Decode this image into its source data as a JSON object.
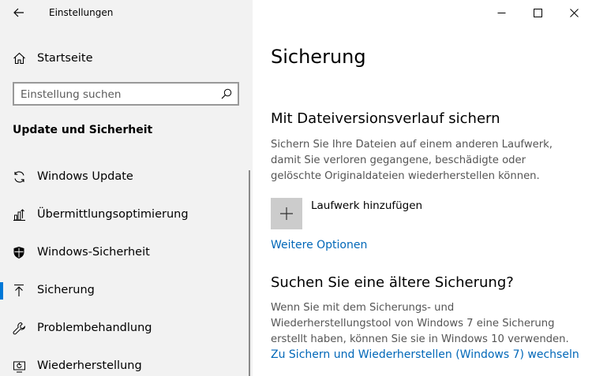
{
  "window": {
    "app_title": "Einstellungen",
    "back_icon": "back-arrow-icon",
    "controls": [
      "minimize-icon",
      "maximize-icon",
      "close-icon"
    ]
  },
  "sidebar": {
    "home_label": "Startseite",
    "home_icon": "home-icon",
    "search_placeholder": "Einstellung suchen",
    "search_icon": "search-icon",
    "section_heading": "Update und Sicherheit",
    "items": [
      {
        "label": "Windows Update",
        "icon": "sync-icon",
        "selected": false
      },
      {
        "label": "Übermittlungsoptimierung",
        "icon": "delivery-optimization-icon",
        "selected": false
      },
      {
        "label": "Windows-Sicherheit",
        "icon": "shield-icon",
        "selected": false
      },
      {
        "label": "Sicherung",
        "icon": "backup-arrow-icon",
        "selected": true
      },
      {
        "label": "Problembehandlung",
        "icon": "wrench-icon",
        "selected": false
      },
      {
        "label": "Wiederherstellung",
        "icon": "recovery-icon",
        "selected": false
      }
    ],
    "accent_color": "#0078d7"
  },
  "main": {
    "title": "Sicherung",
    "file_history": {
      "heading": "Mit Dateiversionsverlauf sichern",
      "description_lines": [
        "Sichern Sie Ihre Dateien auf einem anderen Laufwerk,",
        "damit Sie verloren gegangene, beschädigte oder",
        "gelöschte Originaldateien wiederherstellen können."
      ],
      "add_drive_label": "Laufwerk hinzufügen",
      "add_drive_icon": "plus-icon",
      "more_options_link": "Weitere Optionen"
    },
    "older_backup": {
      "heading": "Suchen Sie eine ältere Sicherung?",
      "description_lines": [
        "Wenn Sie mit dem Sicherungs- und",
        "Wiederherstellungstool von Windows 7 eine Sicherung",
        "erstellt haben, können Sie sie in Windows 10 verwenden."
      ],
      "link": "Zu Sichern und Wiederherstellen (Windows 7) wechseln"
    },
    "link_color": "#0067b8"
  }
}
